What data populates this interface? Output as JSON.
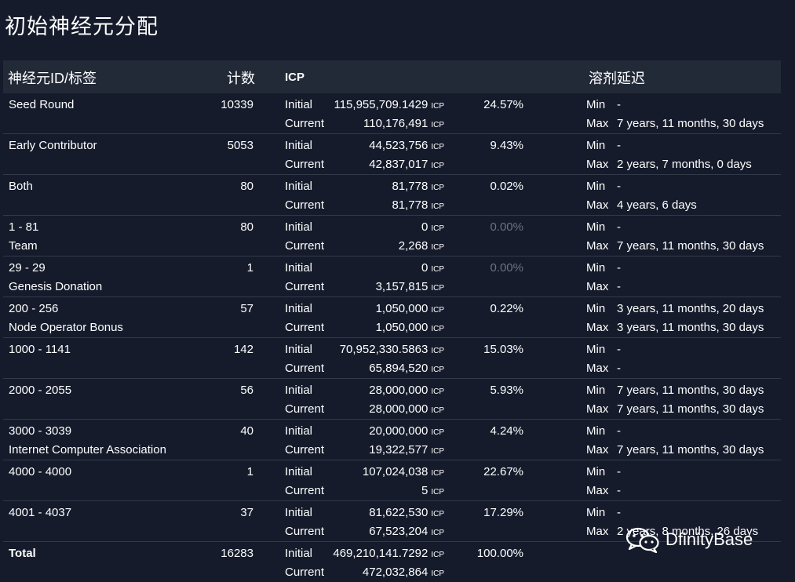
{
  "page": {
    "title": "初始神经元分配"
  },
  "header": {
    "id_tag": "神经元ID/标签",
    "count": "计数",
    "icp": "ICP",
    "dissolve_delay": "溶剂延迟"
  },
  "labels": {
    "initial": "Initial",
    "current": "Current",
    "min": "Min",
    "max": "Max",
    "unit": "ICP"
  },
  "rows": [
    {
      "line1": "Seed Round",
      "line2": "",
      "count": "10339",
      "initial": "115,955,709.1429",
      "current": "110,176,491",
      "pct": "24.57%",
      "pct_dim": false,
      "min": "-",
      "max": "7 years, 11 months, 30 days"
    },
    {
      "line1": "Early Contributor",
      "line2": "",
      "count": "5053",
      "initial": "44,523,756",
      "current": "42,837,017",
      "pct": "9.43%",
      "pct_dim": false,
      "min": "-",
      "max": "2 years, 7 months, 0 days"
    },
    {
      "line1": "Both",
      "line2": "",
      "count": "80",
      "initial": "81,778",
      "current": "81,778",
      "pct": "0.02%",
      "pct_dim": false,
      "min": "-",
      "max": "4 years, 6 days"
    },
    {
      "line1": "1 - 81",
      "line2": "Team",
      "count": "80",
      "initial": "0",
      "current": "2,268",
      "pct": "0.00%",
      "pct_dim": true,
      "min": "-",
      "max": "7 years, 11 months, 30 days"
    },
    {
      "line1": "29 - 29",
      "line2": "Genesis Donation",
      "count": "1",
      "initial": "0",
      "current": "3,157,815",
      "pct": "0.00%",
      "pct_dim": true,
      "min": "-",
      "max": "-"
    },
    {
      "line1": "200 - 256",
      "line2": "Node Operator Bonus",
      "count": "57",
      "initial": "1,050,000",
      "current": "1,050,000",
      "pct": "0.22%",
      "pct_dim": false,
      "min": "3 years, 11 months, 20 days",
      "max": "3 years, 11 months, 30 days"
    },
    {
      "line1": "1000 - 1141",
      "line2": "",
      "count": "142",
      "initial": "70,952,330.5863",
      "current": "65,894,520",
      "pct": "15.03%",
      "pct_dim": false,
      "min": "-",
      "max": "-"
    },
    {
      "line1": "2000 - 2055",
      "line2": "",
      "count": "56",
      "initial": "28,000,000",
      "current": "28,000,000",
      "pct": "5.93%",
      "pct_dim": false,
      "min": "7 years, 11 months, 30 days",
      "max": "7 years, 11 months, 30 days"
    },
    {
      "line1": "3000 - 3039",
      "line2": "Internet Computer Association",
      "count": "40",
      "initial": "20,000,000",
      "current": "19,322,577",
      "pct": "4.24%",
      "pct_dim": false,
      "min": "-",
      "max": "7 years, 11 months, 30 days"
    },
    {
      "line1": "4000 - 4000",
      "line2": "",
      "count": "1",
      "initial": "107,024,038",
      "current": "5",
      "pct": "22.67%",
      "pct_dim": false,
      "min": "-",
      "max": "-"
    },
    {
      "line1": "4001 - 4037",
      "line2": "",
      "count": "37",
      "initial": "81,622,530",
      "current": "67,523,204",
      "pct": "17.29%",
      "pct_dim": false,
      "min": "-",
      "max": "2 years, 8 months, 26 days"
    },
    {
      "line1": "Total",
      "line2": "",
      "count": "16283",
      "initial": "469,210,141.7292",
      "current": "472,032,864",
      "pct": "100.00%",
      "pct_dim": false,
      "min": "",
      "max": "",
      "is_total": true
    }
  ],
  "watermark": {
    "text": "DfinityBase",
    "icon": "wechat-icon"
  }
}
